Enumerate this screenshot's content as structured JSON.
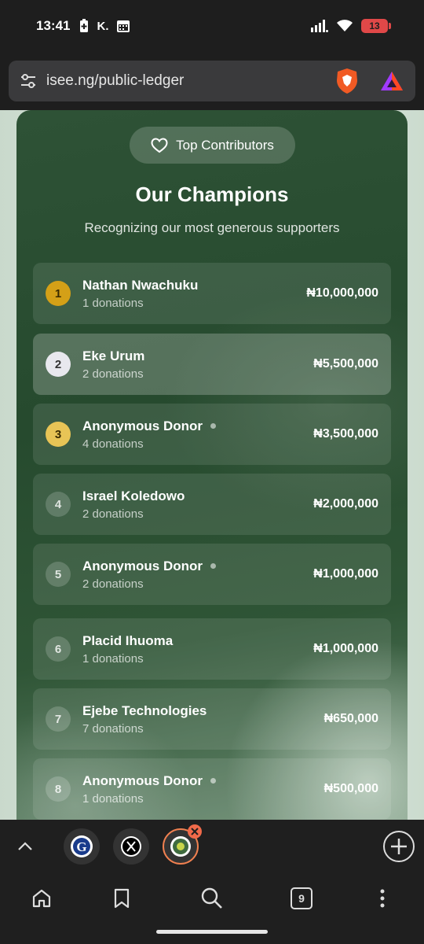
{
  "status_bar": {
    "time": "13:41",
    "left_icons": [
      "battery-saver-icon",
      "k-icon",
      "calendar-icon"
    ],
    "battery": "13"
  },
  "browser": {
    "url": "isee.ng/public-ledger"
  },
  "page": {
    "badge_label": "Top Contributors",
    "title": "Our Champions",
    "subtitle": "Recognizing our most generous supporters",
    "donors": [
      {
        "rank": "1",
        "name": "Nathan Nwachuku",
        "count": "1 donations",
        "amount": "₦10,000,000"
      },
      {
        "rank": "2",
        "name": "Eke Urum",
        "count": "2 donations",
        "amount": "₦5,500,000"
      },
      {
        "rank": "3",
        "name": "Anonymous Donor",
        "count": "4 donations",
        "amount": "₦3,500,000"
      },
      {
        "rank": "4",
        "name": "Israel Koledowo",
        "count": "2 donations",
        "amount": "₦2,000,000"
      },
      {
        "rank": "5",
        "name": "Anonymous Donor",
        "count": "2 donations",
        "amount": "₦1,000,000"
      },
      {
        "rank": "6",
        "name": "Placid Ihuoma",
        "count": "1 donations",
        "amount": "₦1,000,000"
      },
      {
        "rank": "7",
        "name": "Ejebe Technologies",
        "count": "7 donations",
        "amount": "₦650,000"
      },
      {
        "rank": "8",
        "name": "Anonymous Donor",
        "count": "1 donations",
        "amount": "₦500,000"
      }
    ]
  },
  "tab_strip": {
    "tab_count": "9"
  },
  "colors": {
    "gold": "#d4a017",
    "silver": "#e8e8ee",
    "bronze": "#e8c456",
    "card_green": "#2e5236"
  }
}
